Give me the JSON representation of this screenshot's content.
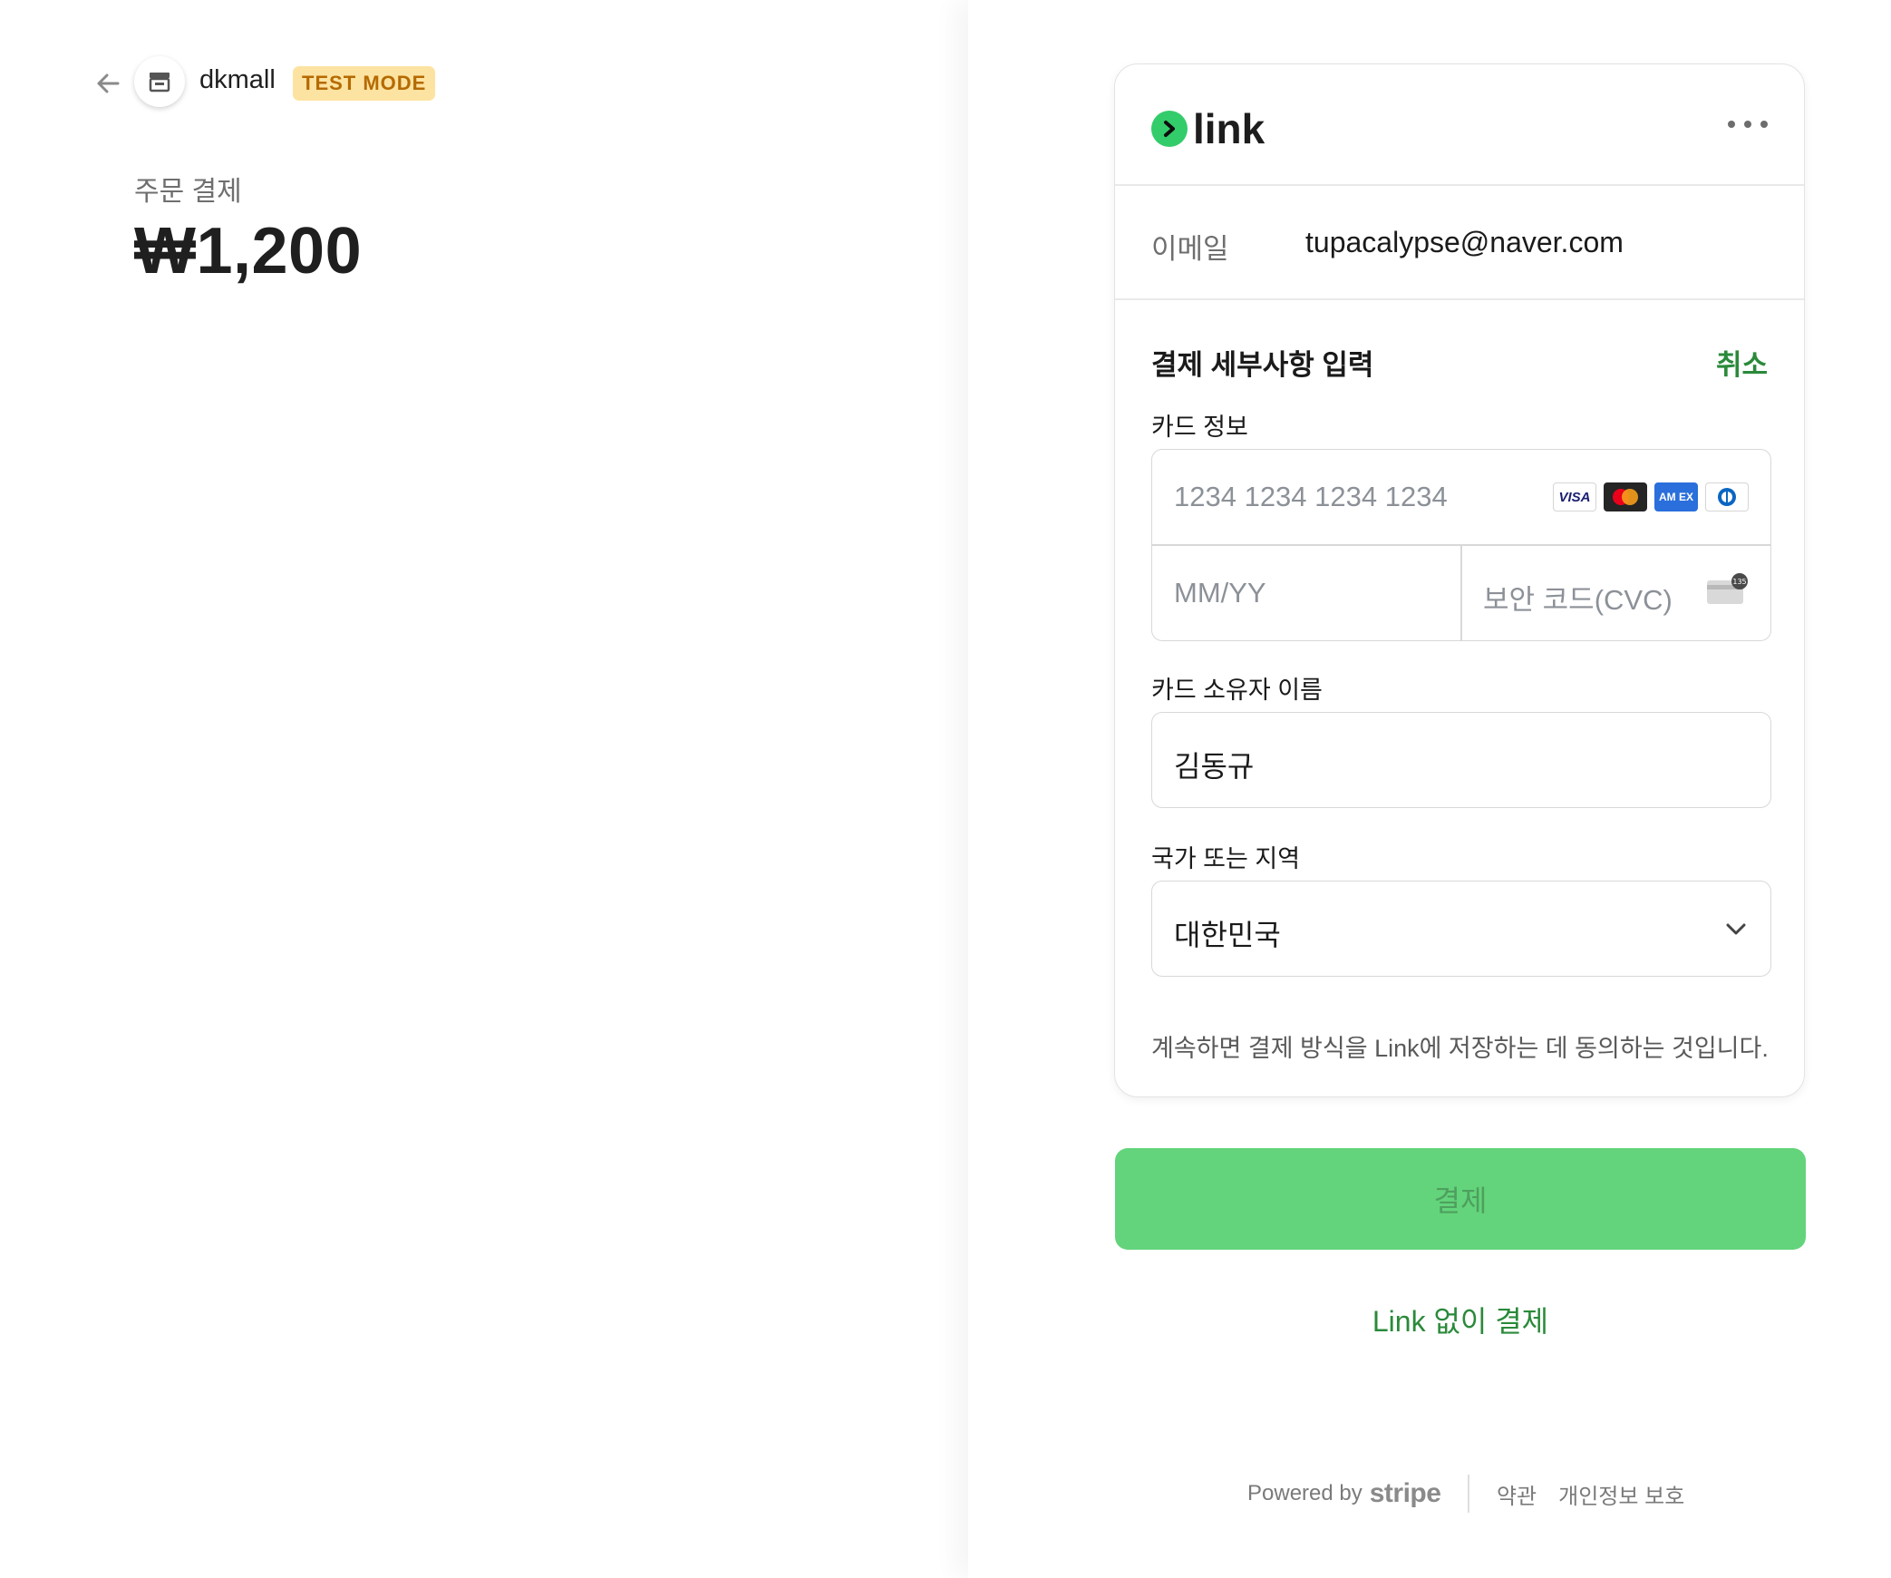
{
  "merchant": {
    "name": "dkmall",
    "badge": "TEST MODE"
  },
  "order": {
    "label": "주문 결제",
    "amount": "₩1,200"
  },
  "link_card": {
    "logo_text": "link",
    "email_label": "이메일",
    "email_value": "tupacalypse@naver.com",
    "section_title": "결제 세부사항 입력",
    "cancel_label": "취소",
    "card_info_label": "카드 정보",
    "card_number_placeholder": "1234 1234 1234 1234",
    "expiry_placeholder": "MM/YY",
    "cvc_placeholder": "보안 코드(CVC)",
    "cvc_icon_text": "135",
    "brands": {
      "visa": "VISA",
      "amex": "AM EX"
    },
    "cardholder_label": "카드 소유자 이름",
    "cardholder_value": "김동규",
    "country_label": "국가 또는 지역",
    "country_value": "대한민국",
    "consent_text": "계속하면 결제 방식을 Link에 저장하는 데 동의하는 것입니다."
  },
  "pay_button": {
    "label": "결제"
  },
  "pay_without_link": {
    "label": "Link 없이 결제"
  },
  "footer": {
    "powered_by": "Powered by",
    "brand": "stripe",
    "terms": "약관",
    "privacy": "개인정보 보호"
  },
  "colors": {
    "accent": "#2a8a3a",
    "pay_button": "#63d47b",
    "badge_bg": "#fde3a1",
    "badge_text": "#b56a00"
  }
}
